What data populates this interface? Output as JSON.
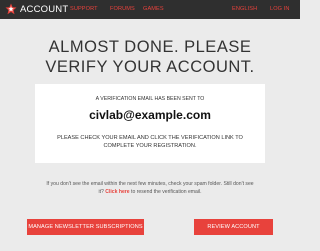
{
  "header": {
    "brand": "ACCOUNT",
    "nav_left": [
      "SUPPORT",
      "FORUMS",
      "GAMES"
    ],
    "nav_right": [
      "ENGLISH",
      "LOG IN"
    ],
    "accent_color": "#e8423c",
    "bar_color": "#2f2f2f",
    "logo_icon": "red-star-logo-icon"
  },
  "main": {
    "title_line1": "ALMOST DONE. PLEASE",
    "title_line2": "VERIFY YOUR ACCOUNT.",
    "panel": {
      "sent_text": "A VERIFICATION EMAIL HAS BEEN SENT TO",
      "email": "civlab@example.com",
      "instruction_line1": "PLEASE CHECK YOUR EMAIL AND CLICK THE VERIFICATION LINK TO",
      "instruction_line2": "COMPLETE YOUR REGISTRATION."
    },
    "notice_line1": "If you don't see the email within the next few minutes, check your spam folder. Still don't see",
    "notice_prefix": "it?",
    "notice_link": "Click here",
    "notice_suffix": "to resend the verification email."
  },
  "buttons": {
    "newsletter": "MANAGE NEWSLETTER SUBSCRIPTIONS",
    "review": "REVIEW ACCOUNT"
  }
}
